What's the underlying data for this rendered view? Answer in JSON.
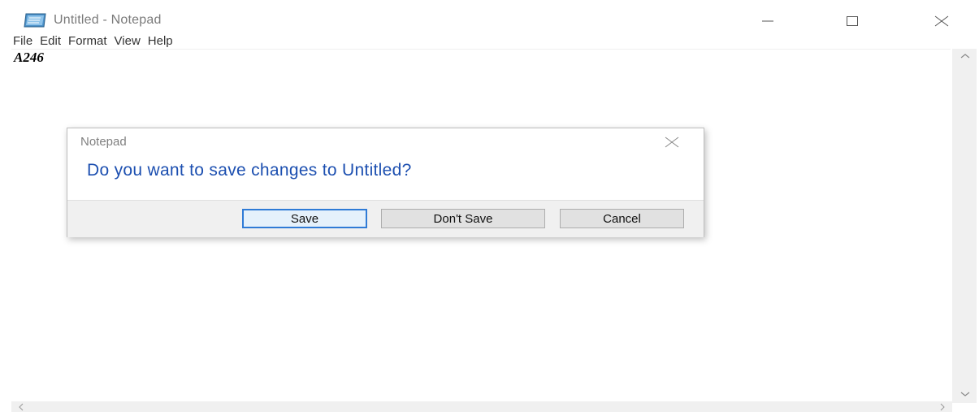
{
  "window": {
    "title": "Untitled - Notepad"
  },
  "menu": {
    "items": [
      "File",
      "Edit",
      "Format",
      "View",
      "Help"
    ]
  },
  "editor": {
    "content": "A246"
  },
  "dialog": {
    "title": "Notepad",
    "message": "Do you want to save changes to Untitled?",
    "buttons": {
      "save": "Save",
      "dont_save": "Don't Save",
      "cancel": "Cancel"
    }
  },
  "scrollbars": {
    "up_glyph": "︿",
    "down_glyph": "﹀",
    "left_glyph": "<",
    "right_glyph": ">"
  },
  "colors": {
    "dialog_message": "#1c4fb0",
    "default_button_border": "#2f7bd6",
    "footer_bg": "#f0f0f0"
  },
  "icons": {
    "app": "notepad-icon",
    "minimize": "minimize-icon",
    "maximize": "maximize-icon",
    "close": "close-icon"
  }
}
